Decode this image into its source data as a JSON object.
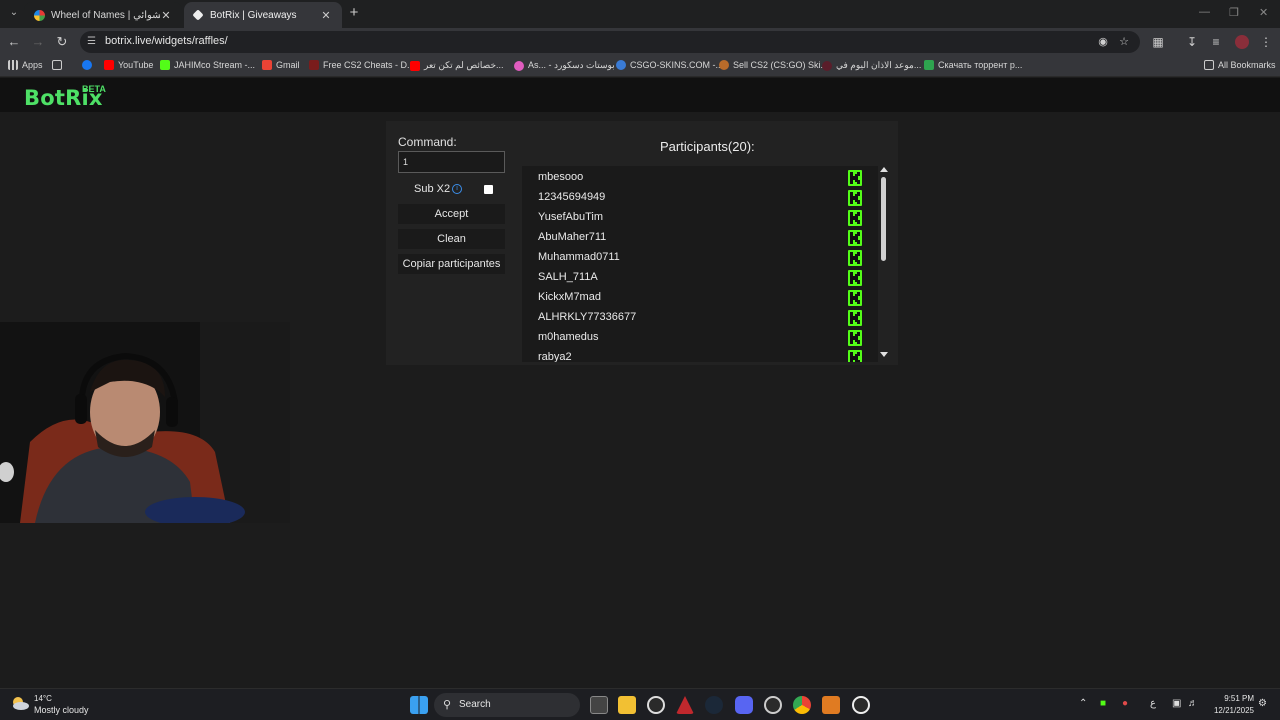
{
  "browser": {
    "tabs": [
      {
        "title": "Wheel of Names | اسم العشوائي",
        "active": false
      },
      {
        "title": "BotRix | Giveaways",
        "active": true
      }
    ],
    "url": "botrix.live/widgets/raffles/",
    "bookmarks": [
      "Apps",
      "YouTube",
      "JAHIMco Stream -...",
      "Gmail",
      "Free CS2 Cheats - D...",
      "خصائص لم تكن تعر...",
      "As... - بوستات دسكورد",
      "CSGO-SKINS.COM -...",
      "Sell CS2 (CS:GO) Ski...",
      "موعد الاذان اليوم في...",
      "Скачать торрент p..."
    ],
    "all_bookmarks": "All Bookmarks"
  },
  "app": {
    "logo": "BotRix",
    "logo_badge": "BETA"
  },
  "raffle": {
    "command_label": "Command:",
    "command_value": "1",
    "subx2_label": "Sub X2",
    "subx2_checked": false,
    "accept_label": "Accept",
    "clean_label": "Clean",
    "copy_label": "Copiar participantes",
    "participants_title": "Participants(20):",
    "participants": [
      "mbesooo",
      "12345694949",
      "YusefAbuTim",
      "AbuMaher711",
      "Muhammad0711",
      "SALH_711A",
      "KickxM7mad",
      "ALHRKLY77336677",
      "m0hamedus",
      "rabya2"
    ],
    "platform_icon": "kick-icon",
    "platform_color": "#53fc18"
  },
  "taskbar": {
    "weather_temp": "14°C",
    "weather_desc": "Mostly cloudy",
    "search_label": "Search",
    "lang": "ع",
    "time": "9:51 PM",
    "date": "12/21/2025"
  }
}
